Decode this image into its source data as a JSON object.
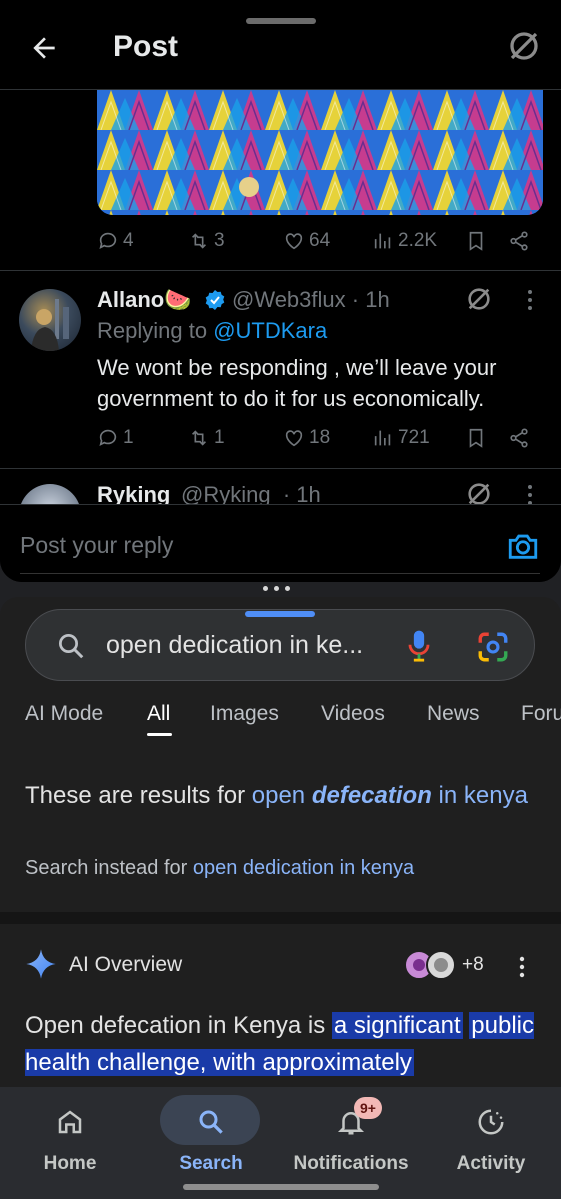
{
  "x_app": {
    "header": {
      "title": "Post"
    },
    "post_actions": {
      "replies": "4",
      "reposts": "3",
      "likes": "64",
      "views": "2.2K"
    },
    "reply1": {
      "name": "Allano🍉",
      "handle": "@Web3flux",
      "time": "· 1h",
      "replying_prefix": "Replying to ",
      "replying_to": "@UTDKara",
      "text": "We wont be responding , we’ll leave your government to do it for us economically.",
      "actions": {
        "replies": "1",
        "reposts": "1",
        "likes": "18",
        "views": "721"
      }
    },
    "reply2": {
      "name": "Ryking",
      "handle": "@Ryking",
      "time": "· 1h"
    },
    "reply_box": {
      "placeholder": "Post your reply"
    }
  },
  "google_app": {
    "search": {
      "query": "open dedication in ke..."
    },
    "tabs": [
      "AI Mode",
      "All",
      "Images",
      "Videos",
      "News",
      "Foru"
    ],
    "active_tab": "All",
    "correction": {
      "prefix": "These are results for ",
      "corrected_plain": "open ",
      "corrected_bold": "defecation",
      "corrected_rest": " in kenya",
      "instead_prefix": "Search instead for ",
      "instead_link": "open dedication in kenya"
    },
    "ai_overview": {
      "title": "AI Overview",
      "source_count": "+8",
      "text_plain": "Open defecation in Kenya is ",
      "text_highlight_1": "a significant",
      "text_highlight_2": "public health challenge, with approximately"
    },
    "bottom_nav": {
      "home": "Home",
      "search": "Search",
      "notifications": "Notifications",
      "notifications_badge": "9+",
      "activity": "Activity"
    },
    "colors": {
      "accent": "#8ab4f8",
      "highlight": "#1a3ba8",
      "x_blue": "#1d9bf0"
    }
  }
}
